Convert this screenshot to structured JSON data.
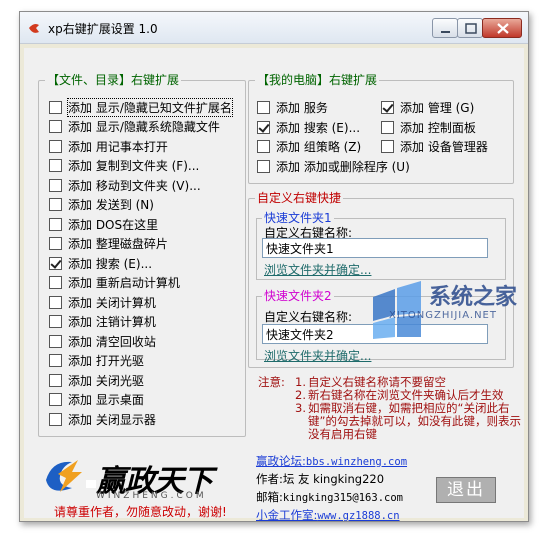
{
  "window": {
    "title": "xp右键扩展设置 1.0"
  },
  "left_group": {
    "title": "【文件、目录】右键扩展",
    "items": [
      {
        "label": "添加 显示/隐藏已知文件扩展名",
        "checked": false
      },
      {
        "label": "添加 显示/隐藏系统隐藏文件",
        "checked": false
      },
      {
        "label": "添加 用记事本打开",
        "checked": false
      },
      {
        "label": "添加 复制到文件夹 (F)...",
        "checked": false
      },
      {
        "label": "添加 移动到文件夹 (V)...",
        "checked": false
      },
      {
        "label": "添加 发送到 (N)",
        "checked": false
      },
      {
        "label": "添加 DOS在这里",
        "checked": false
      },
      {
        "label": "添加 整理磁盘碎片",
        "checked": false
      },
      {
        "label": "添加 搜索 (E)...",
        "checked": true
      },
      {
        "label": "添加 重新启动计算机",
        "checked": false
      },
      {
        "label": "添加 关闭计算机",
        "checked": false
      },
      {
        "label": "添加 注销计算机",
        "checked": false
      },
      {
        "label": "添加 清空回收站",
        "checked": false
      },
      {
        "label": "添加 打开光驱",
        "checked": false
      },
      {
        "label": "添加 关闭光驱",
        "checked": false
      },
      {
        "label": "添加 显示桌面",
        "checked": false
      },
      {
        "label": "添加 关闭显示器",
        "checked": false
      }
    ]
  },
  "right_group": {
    "title": "【我的电脑】右键扩展",
    "items": [
      {
        "label": "添加 服务",
        "checked": false
      },
      {
        "label": "添加 管理 (G)",
        "checked": true
      },
      {
        "label": "添加 搜索 (E)...",
        "checked": true
      },
      {
        "label": "添加 控制面板",
        "checked": false
      },
      {
        "label": "添加 组策略 (Z)",
        "checked": false
      },
      {
        "label": "添加 设备管理器",
        "checked": false
      },
      {
        "label": "添加 添加或删除程序 (U)",
        "checked": false
      }
    ]
  },
  "custom_group": {
    "title": "自定义右键快捷",
    "folder1": {
      "title": "快速文件夹1",
      "name_label": "自定义右键名称:",
      "value": "快速文件夹1",
      "browse_link": "浏览文件夹并确定..."
    },
    "folder2": {
      "title": "快速文件夹2",
      "name_label": "自定义右键名称:",
      "value": "快速文件夹2",
      "browse_link": "浏览文件夹并确定..."
    }
  },
  "notes": {
    "label": "注意:",
    "items": [
      {
        "num": "1.",
        "text": "自定义右键名称请不要留空"
      },
      {
        "num": "2.",
        "text": "新右键名称在浏览文件夹确认后才生效"
      },
      {
        "num": "3.",
        "text": "如需取消右键，如需把相应的“关闭此右键”的勾去掉就可以，如没有此键，则表示没有启用右键"
      }
    ]
  },
  "logo": {
    "name": "赢政天下",
    "url": "WINZHENG.COM",
    "tagline": "请尊重作者，勿随意改动，谢谢!"
  },
  "info": {
    "forum_label": "赢政论坛:",
    "forum_url": "bbs.winzheng.com",
    "author_label": "作者:",
    "author_value": "坛 友 kingking220",
    "email_label": "邮箱:",
    "email_value": "kingking315@163.com",
    "studio_label": "小金工作室:",
    "studio_url": "www.gz1888.cn"
  },
  "exit_button": {
    "label": "退出"
  },
  "watermark": {
    "brand": "系统之家",
    "url": "XITONGZHIJIA.NET"
  },
  "colors": {
    "group_title": "#006400",
    "custom_title": "#c00000",
    "folder1_title": "#1a3cd6",
    "folder2_title": "#d000d0",
    "notes_text": "#a01010",
    "exit_bg": "#b0b0b0"
  }
}
